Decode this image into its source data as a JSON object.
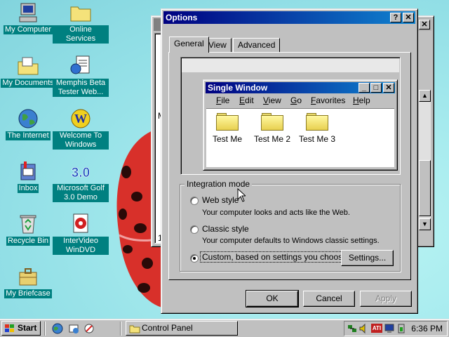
{
  "desktop_icons": [
    {
      "label": "My Computer",
      "icon": "computer-icon"
    },
    {
      "label": "Online Services",
      "icon": "folder-icon"
    },
    {
      "label": "My Documents",
      "icon": "documents-folder-icon"
    },
    {
      "label": "Memphis Beta Tester Web...",
      "icon": "web-document-icon"
    },
    {
      "label": "The Internet",
      "icon": "internet-globe-icon"
    },
    {
      "label": "Welcome To Windows",
      "icon": "welcome-w-icon"
    },
    {
      "label": "Inbox",
      "icon": "inbox-icon"
    },
    {
      "label": "Microsoft Golf 3.0 Demo",
      "icon": "golf-icon"
    },
    {
      "label": "Recycle Bin",
      "icon": "recycle-bin-icon"
    },
    {
      "label": "InterVideo WinDVD",
      "icon": "dvd-icon"
    },
    {
      "label": "My Briefcase",
      "icon": "briefcase-icon"
    }
  ],
  "dialog": {
    "title": "Options",
    "help_button": "?",
    "close_button": "✕",
    "tabs": [
      {
        "label": "General",
        "active": true
      },
      {
        "label": "View",
        "active": false
      },
      {
        "label": "Advanced",
        "active": false
      }
    ],
    "preview": {
      "title": "Single Window",
      "menu": [
        "File",
        "Edit",
        "View",
        "Go",
        "Favorites",
        "Help"
      ],
      "folders": [
        "Test Me",
        "Test Me 2",
        "Test Me 3"
      ]
    },
    "integration": {
      "group_label": "Integration mode",
      "options": [
        {
          "label": "Web style",
          "description": "Your computer looks and acts like the Web.",
          "checked": false
        },
        {
          "label": "Classic style",
          "description": "Your computer defaults to Windows classic settings.",
          "checked": false
        },
        {
          "label": "Custom, based on settings you choose",
          "description": "",
          "checked": true
        }
      ],
      "settings_button": "Settings..."
    },
    "buttons": {
      "ok": "OK",
      "cancel": "Cancel",
      "apply": "Apply"
    }
  },
  "background_window": {
    "close_button": "✕",
    "partial_text_m": "M",
    "partial_text_1": "1"
  },
  "taskbar": {
    "start_label": "Start",
    "quick_launch": [
      "ie-icon",
      "outlook-icon",
      "channels-icon"
    ],
    "task_button": "Control Panel",
    "tray_icons": [
      "network-icon",
      "volume-icon",
      "ati-icon",
      "display-icon",
      "power-icon"
    ],
    "ati_label": "ATI",
    "clock": "6:36 PM"
  },
  "colors": {
    "desktop": "#8fdce4",
    "titlebar_active": "#000080",
    "desktop_label_bg": "#008080"
  }
}
